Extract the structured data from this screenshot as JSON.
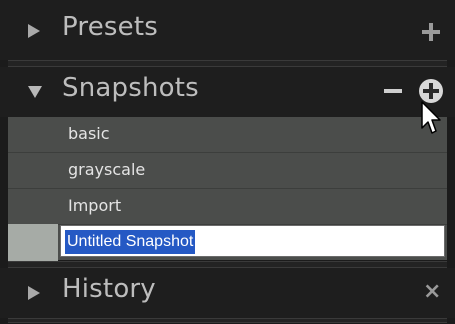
{
  "panel": {
    "presets": {
      "label": "Presets",
      "add_icon": "plus-icon"
    },
    "snapshots": {
      "label": "Snapshots",
      "remove_icon": "minus-icon",
      "add_icon": "plus-circle-icon",
      "items": [
        {
          "label": "basic"
        },
        {
          "label": "grayscale"
        },
        {
          "label": "Import"
        }
      ],
      "editing_value": "Untitled Snapshot"
    },
    "history": {
      "label": "History",
      "clear_icon": "x-icon"
    }
  },
  "colors": {
    "background": "#1b1b1b",
    "list_background": "#4b4d4b",
    "selection": "#2559c4",
    "header_text": "#bdbdbd"
  }
}
